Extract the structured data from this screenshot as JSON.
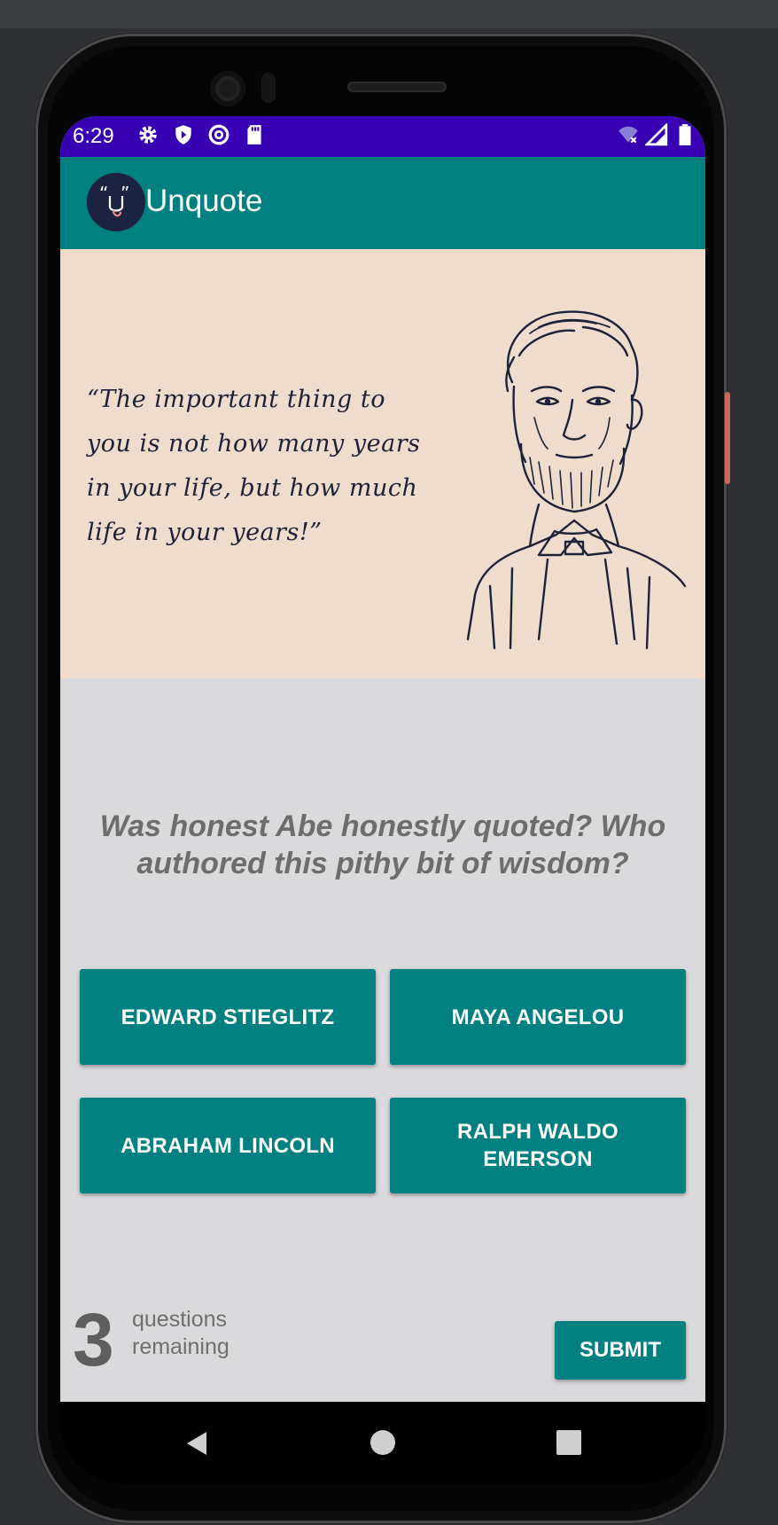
{
  "status_bar": {
    "time": "6:29",
    "left_icons": [
      "gear-icon",
      "shield-icon",
      "at-sign-icon",
      "sd-card-icon"
    ],
    "right_icons": [
      "wifi-off-icon",
      "cell-signal-icon",
      "battery-icon"
    ]
  },
  "app_bar": {
    "title": "Unquote",
    "logo_icon": "unquote-logo-icon"
  },
  "quote": {
    "text": "“The important thing to you is not how many years in your life, but how much life in your years!”",
    "image_icon": "abraham-lincoln-portrait"
  },
  "question": "Was honest Abe honestly quoted? Who authored this pithy bit of wisdom?",
  "answers": [
    {
      "label": "EDWARD STIEGLITZ"
    },
    {
      "label": "MAYA ANGELOU"
    },
    {
      "label": "ABRAHAM LINCOLN"
    },
    {
      "label": "RALPH WALDO EMERSON"
    }
  ],
  "footer": {
    "remaining_count": "3",
    "remaining_label": "questions remaining",
    "submit_label": "SUBMIT"
  },
  "nav_bar": {
    "icons": [
      "back-icon",
      "home-icon",
      "recents-icon"
    ]
  },
  "colors": {
    "status_bar": "#3700b3",
    "primary": "#008080",
    "quote_background": "#f0dccd",
    "screen_background": "#dadadc"
  }
}
